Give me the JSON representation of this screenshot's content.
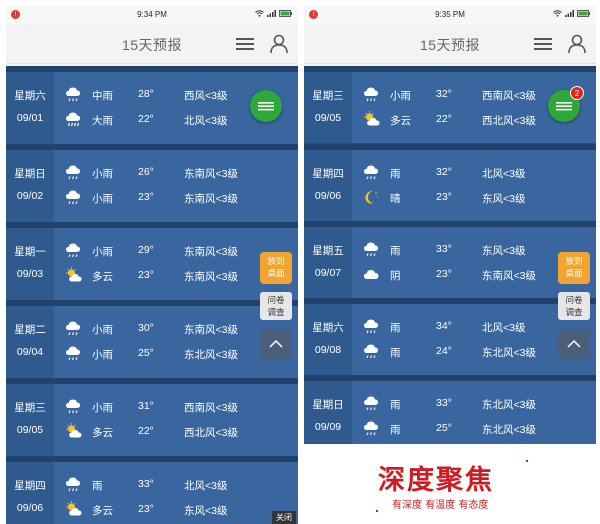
{
  "colors": {
    "day_bg": "#2f5a8e",
    "detail_bg": "#3a66a0",
    "separator": "#21436b",
    "chat_green": "#2fa83a",
    "desk_orange": "#f2a431",
    "watermark_red": "#d21a22"
  },
  "left": {
    "status_time": "9:34 PM",
    "title": "15天预报",
    "desk_button": "放到\n桌面",
    "survey_button": "问卷\n调查",
    "close_label": "关闭",
    "days": [
      {
        "weekday": "星期六",
        "date": "09/01",
        "rows": [
          {
            "icon": "rain-icon",
            "cond": "中雨",
            "temp": "28°",
            "wind": "西风<3级"
          },
          {
            "icon": "heavy-rain-icon",
            "cond": "大雨",
            "temp": "22°",
            "wind": "北风<3级"
          }
        ]
      },
      {
        "weekday": "星期日",
        "date": "09/02",
        "rows": [
          {
            "icon": "rain-icon",
            "cond": "小雨",
            "temp": "26°",
            "wind": "东南风<3级"
          },
          {
            "icon": "rain-icon",
            "cond": "小雨",
            "temp": "23°",
            "wind": "东南风<3级"
          }
        ]
      },
      {
        "weekday": "星期一",
        "date": "09/03",
        "rows": [
          {
            "icon": "rain-icon",
            "cond": "小雨",
            "temp": "29°",
            "wind": "东南风<3级"
          },
          {
            "icon": "partly-cloudy-icon",
            "cond": "多云",
            "temp": "23°",
            "wind": "东南风<3级"
          }
        ]
      },
      {
        "weekday": "星期二",
        "date": "09/04",
        "rows": [
          {
            "icon": "rain-icon",
            "cond": "小雨",
            "temp": "30°",
            "wind": "东南风<3级"
          },
          {
            "icon": "rain-icon",
            "cond": "小雨",
            "temp": "25°",
            "wind": "东北风<3级"
          }
        ]
      },
      {
        "weekday": "星期三",
        "date": "09/05",
        "rows": [
          {
            "icon": "rain-icon",
            "cond": "小雨",
            "temp": "31°",
            "wind": "西南风<3级"
          },
          {
            "icon": "partly-cloudy-icon",
            "cond": "多云",
            "temp": "22°",
            "wind": "西北风<3级"
          }
        ]
      },
      {
        "weekday": "星期四",
        "date": "09/06",
        "rows": [
          {
            "icon": "rain-icon",
            "cond": "雨",
            "temp": "33°",
            "wind": "北风<3级"
          },
          {
            "icon": "partly-cloudy-icon",
            "cond": "多云",
            "temp": "23°",
            "wind": "东风<3级"
          }
        ]
      }
    ]
  },
  "right": {
    "status_time": "9:35 PM",
    "title": "15天预报",
    "chat_badge": "2",
    "desk_button": "放到\n桌面",
    "survey_button": "问卷\n调查",
    "days": [
      {
        "weekday": "星期三",
        "date": "09/05",
        "rows": [
          {
            "icon": "rain-icon",
            "cond": "小雨",
            "temp": "32°",
            "wind": "西南风<3级"
          },
          {
            "icon": "partly-cloudy-icon",
            "cond": "多云",
            "temp": "22°",
            "wind": "西北风<3级"
          }
        ]
      },
      {
        "weekday": "星期四",
        "date": "09/06",
        "rows": [
          {
            "icon": "rain-icon",
            "cond": "雨",
            "temp": "32°",
            "wind": "北风<3级"
          },
          {
            "icon": "moon-icon",
            "cond": "晴",
            "temp": "23°",
            "wind": "东风<3级"
          }
        ]
      },
      {
        "weekday": "星期五",
        "date": "09/07",
        "rows": [
          {
            "icon": "rain-icon",
            "cond": "雨",
            "temp": "33°",
            "wind": "东风<3级"
          },
          {
            "icon": "cloud-icon",
            "cond": "阴",
            "temp": "23°",
            "wind": "东南风<3级"
          }
        ]
      },
      {
        "weekday": "星期六",
        "date": "09/08",
        "rows": [
          {
            "icon": "rain-icon",
            "cond": "雨",
            "temp": "34°",
            "wind": "北风<3级"
          },
          {
            "icon": "rain-icon",
            "cond": "雨",
            "temp": "24°",
            "wind": "东北风<3级"
          }
        ]
      },
      {
        "weekday": "星期日",
        "date": "09/09",
        "rows": [
          {
            "icon": "rain-icon",
            "cond": "雨",
            "temp": "33°",
            "wind": "东北风<3级"
          },
          {
            "icon": "rain-icon",
            "cond": "雨",
            "temp": "25°",
            "wind": "东北风<3级"
          }
        ]
      }
    ]
  },
  "watermark": {
    "title": "深度聚焦",
    "subtitle": "有深度 有温度 有态度"
  }
}
